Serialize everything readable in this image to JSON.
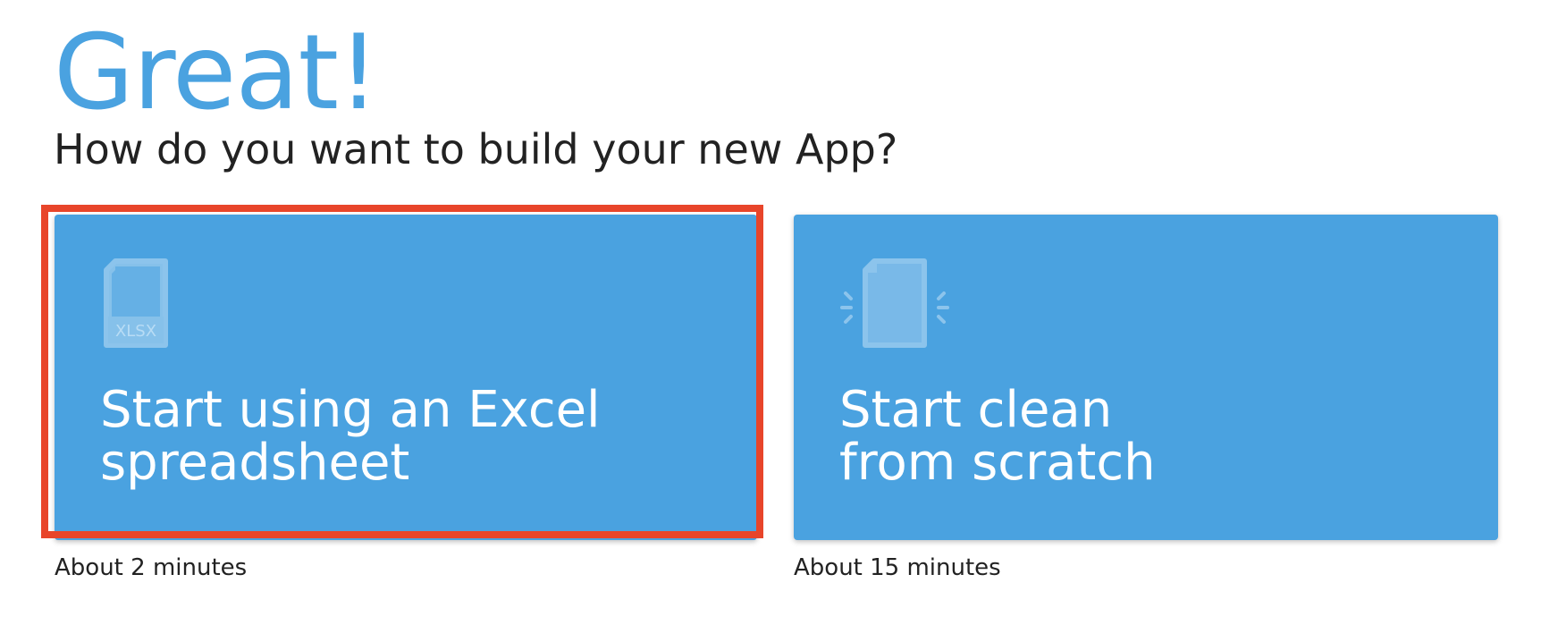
{
  "header": {
    "title": "Great!",
    "subtitle": "How do you want to build your new App?"
  },
  "options": [
    {
      "id": "excel",
      "icon": "xlsx-file-icon",
      "icon_label": "XLSX",
      "title_line1": "Start using an Excel",
      "title_line2": "spreadsheet",
      "duration": "About 2 minutes",
      "highlighted": true
    },
    {
      "id": "scratch",
      "icon": "blank-file-sparkle-icon",
      "title_line1": "Start clean",
      "title_line2": "from scratch",
      "duration": "About 15 minutes",
      "highlighted": false
    }
  ],
  "colors": {
    "accent": "#4aa2e0",
    "highlight_border": "#e8452a",
    "text": "#222222",
    "card_text": "#ffffff"
  }
}
